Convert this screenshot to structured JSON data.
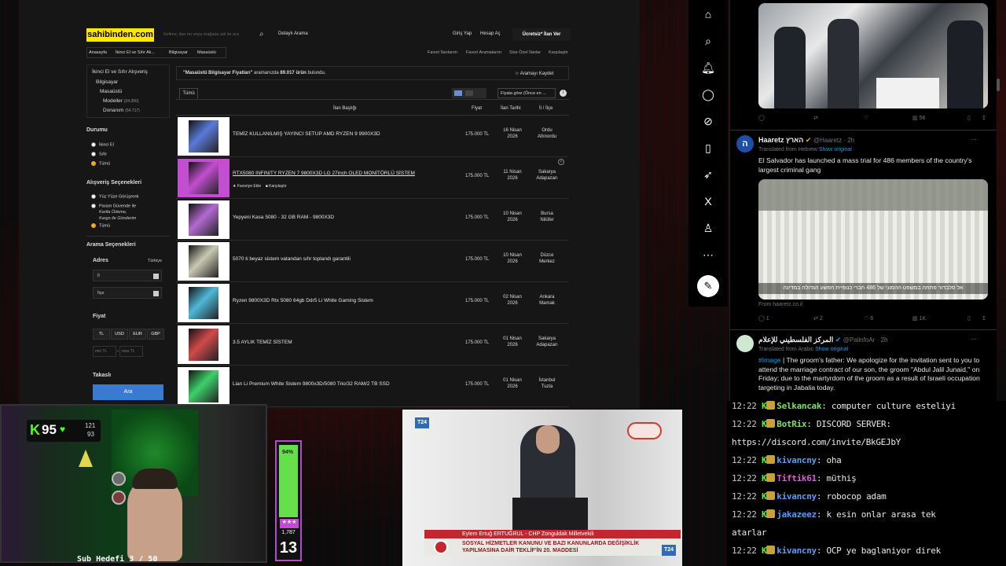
{
  "site": {
    "logo": "sahibinden.com",
    "search_placeholder": "Kelime, ilan no veya mağaza adı ile ara",
    "detailed_search": "Detaylı Arama",
    "login": "Giriş Yap",
    "register": "Hesap Aç",
    "post_ad": "Ücretsiz* İlan Ver",
    "breadcrumb": [
      "Anasayfa",
      "İkinci El ve Sıfır Alı...",
      "Bilgisayar",
      "Masaüstü"
    ],
    "links": [
      "Favori İlanlarım",
      "Favori Aramalarım",
      "Size Özel İlanlar",
      "Karşılaştır"
    ],
    "categories": {
      "c1": "İkinci El ve Sıfır Alışveriş",
      "c2": "Bilgisayar",
      "c3": "Masaüstü",
      "c4": "Modeller",
      "c4n": "(34.300)",
      "c5": "Donanım",
      "c5n": "(54.717)"
    },
    "condition_title": "Durumu",
    "condition": [
      "İkinci El",
      "Sıfır",
      "Tümü"
    ],
    "shopping_title": "Alışveriş Seçenekleri",
    "shopping": [
      "Yüz Yüze Görüşerek",
      "Param Güvende ile",
      "Kartla Ödeme,",
      "Kargo ile Gönderim",
      "Tümü"
    ],
    "search_options_title": "Arama Seçenekleri",
    "address_label": "Adres",
    "country": "Türkiye",
    "il": "İl",
    "ilce": "İlçe",
    "price_label": "Fiyat",
    "currencies": [
      "TL",
      "USD",
      "EUR",
      "GBP"
    ],
    "min_ph": "min TL",
    "max_ph": "max TL",
    "takasli": "Takaslı",
    "ara": "Ara",
    "result_query": "\"Masaüstü Bilgisayar Fiyatları\"",
    "result_mid": " aramanızda ",
    "result_count": "89.017 ürün",
    "result_end": " bulundu.",
    "save_search": "Aramayı Kaydet",
    "tab_all": "Tümü",
    "sort": "Fiyata göre (Önce en ...",
    "col_title": "İlan Başlığı",
    "col_price": "Fiyat",
    "col_date": "İlan Tarihi",
    "col_loc": "İl / İlçe",
    "fav_add": "Favoriye Ekle",
    "compare": "Karşılaştır",
    "listings": [
      {
        "title": "TEMİZ KULLANILMIŞ YAYINCI SETUP AMD RYZEN 9 9900X3D",
        "price": "175.000 TL",
        "date1": "16 Nisan",
        "date2": "2026",
        "loc1": "Ordu",
        "loc2": "Altınordu",
        "color": "#5a7ad8"
      },
      {
        "title": "RTX5080 INFINITY RYZEN 7 9800X3D LG 27inch OLED MONİTÖRLÜ SİSTEM",
        "price": "175.000 TL",
        "date1": "11 Nisan",
        "date2": "2026",
        "loc1": "Sakarya",
        "loc2": "Adapazarı",
        "color": "#c24fd0"
      },
      {
        "title": "Yepyeni Kasa 5080 - 32 GB RAM - 9800X3D",
        "price": "175.000 TL",
        "date1": "10 Nisan",
        "date2": "2026",
        "loc1": "Bursa",
        "loc2": "Nilüfer",
        "color": "#b26ad0"
      },
      {
        "title": "5070 ti beyaz sistem vatandan sıfır toplandı garantili",
        "price": "175.000 TL",
        "date1": "10 Nisan",
        "date2": "2026",
        "loc1": "Düzce",
        "loc2": "Merkez",
        "color": "#c9c9b2"
      },
      {
        "title": "Ryzen 9800X3D Rtx 5080 64gb Ddr5 Li White Gaming Sistem",
        "price": "175.000 TL",
        "date1": "02 Nisan",
        "date2": "2026",
        "loc1": "Ankara",
        "loc2": "Mamak",
        "color": "#4fb8d8"
      },
      {
        "title": "3.5 AYLIK TEMİZ SİSTEM",
        "price": "175.000 TL",
        "date1": "01 Nisan",
        "date2": "2026",
        "loc1": "Sakarya",
        "loc2": "Adapazarı",
        "color": "#d04a4a"
      },
      {
        "title": "Lian Li Premium White Sistem 9800x3D/5080 Trio/32 RAM/2 TB SSD",
        "price": "175.000 TL",
        "date1": "01 Nisan",
        "date2": "2026",
        "loc1": "İstanbul",
        "loc2": "Tuzla",
        "color": "#3ed06a"
      }
    ]
  },
  "feed": {
    "post1": {
      "actions": [
        "",
        "",
        "",
        "56",
        "",
        ""
      ]
    },
    "post2": {
      "name": "Haaretz הארץ",
      "handle": "@Haaretz · 2h",
      "translated": "Translated from Hebrew",
      "show": "Show original",
      "text": "El Salvador has launched a mass trial for 486 members of the country's largest criminal gang",
      "caption": "אל סלבדור פתחה במשפט ההמוני של 486 חברי כנופיית הפשע הגדולה במדינה",
      "source": "From haaretz.co.il",
      "actions": [
        "1",
        "2",
        "6",
        "1K"
      ]
    },
    "post3": {
      "name": "المركز الفلسطيني للإعلام",
      "handle": "@PalinfoAr · 2h",
      "translated": "Translated from Arabic",
      "show": "Show original",
      "tag": "#Image",
      "text": " | The groom's father: We apologize for the invitation sent to you to attend the marriage contract of our son, the groom \"Abdul Jalil Junaid,\" on Friday; due to the martyrdom of the groom as a result of Israeli occupation targeting in Jabalia today."
    }
  },
  "chat": [
    {
      "time": "12:22",
      "user": "Selkancak",
      "msg": ": computer culture esteliyi",
      "color": "#7ee35a"
    },
    {
      "time": "12:22",
      "user": "BotRix",
      "msg": ": DISCORD SERVER:",
      "color": "#7ee35a"
    },
    {
      "time": "",
      "user": "",
      "msg": "https://discord.com/invite/BkGEJbY",
      "color": "#e8e8e8"
    },
    {
      "time": "12:22",
      "user": "kivancny",
      "msg": ": oha",
      "color": "#5b9cf5"
    },
    {
      "time": "12:22",
      "user": "Tiftik61",
      "msg": ": müthiş",
      "color": "#e05bd0"
    },
    {
      "time": "12:22",
      "user": "kivancny",
      "msg": ": robocop adam",
      "color": "#5b9cf5"
    },
    {
      "time": "12:22",
      "user": "jakazeez",
      "msg": ": k esin onlar arasa tek",
      "color": "#5b9cf5"
    },
    {
      "time": "",
      "user": "",
      "msg": "atarlar",
      "color": "#e8e8e8"
    },
    {
      "time": "12:22",
      "user": "kivancny",
      "msg": ": OCP ye baglaniyor direk",
      "color": "#5b9cf5"
    }
  ],
  "stream": {
    "k_score": "95",
    "stat1": "121",
    "stat2": "93",
    "percent": "94%",
    "count": "1,787",
    "level": "13",
    "sub_goal": "Sub Hedefi 3 / 50"
  },
  "tv": {
    "channel": "T24",
    "name": "Eylem Ertuğ ERTUĞRUL - CHP Zonguldak Milletvekili",
    "line1": "SOSYAL HİZMETLER KANUNU VE BAZI KANUNLARDA DEĞİŞİKLİK",
    "line2": "YAPILMASINA DAİR TEKLİF'İN 20. MADDESİ"
  }
}
